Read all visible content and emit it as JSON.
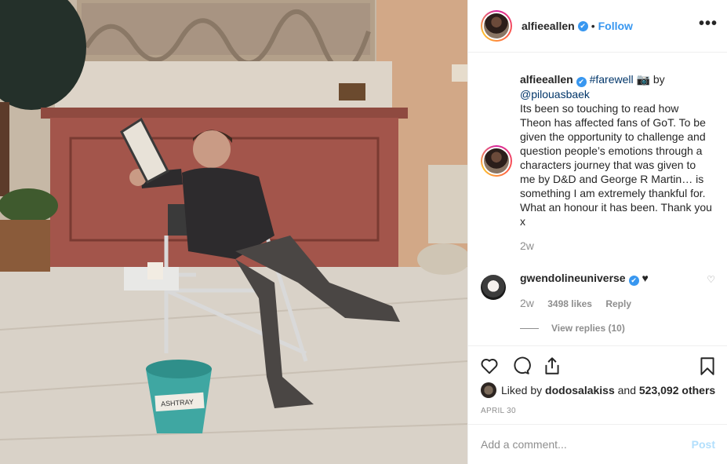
{
  "header": {
    "username": "alfieeallen",
    "verified_glyph": "✔",
    "separator": "•",
    "follow_label": "Follow",
    "more_glyph": "•••"
  },
  "caption": {
    "username": "alfieeallen",
    "hashtag": "#farewell",
    "camera_glyph": "📷",
    "by_text": "by",
    "mention": "@pilouasbaek",
    "text": "Its been so touching to read how Theon has affected fans of GoT. To be given the opportunity to challenge and question people’s emotions through a characters journey that was given to me by D&D and George R Martin… is something I am extremely thankful for. What an honour it has been. Thank you x",
    "time": "2w"
  },
  "comment": {
    "username": "gwendolineuniverse",
    "text": "♥",
    "time": "2w",
    "likes": "3498 likes",
    "reply_label": "Reply",
    "view_replies": "View replies (10)"
  },
  "likes": {
    "prefix": "Liked by",
    "user": "dodosalakiss",
    "middle": "and",
    "others": "523,092 others"
  },
  "date": "APRIL 30",
  "add_comment": {
    "placeholder": "Add a comment...",
    "post_label": "Post"
  },
  "photo": {
    "bucket_label": "ASHTRAY"
  },
  "colors": {
    "link": "#3897f0",
    "hashtag": "#003569",
    "muted": "#8e8e8e",
    "post_disabled": "#b2dffc",
    "verified": "#3897f0"
  },
  "icons": [
    "verified-badge-icon",
    "more-options-icon",
    "camera-emoji-icon",
    "heart-icon",
    "comment-icon",
    "share-icon",
    "bookmark-icon",
    "small-heart-icon"
  ]
}
